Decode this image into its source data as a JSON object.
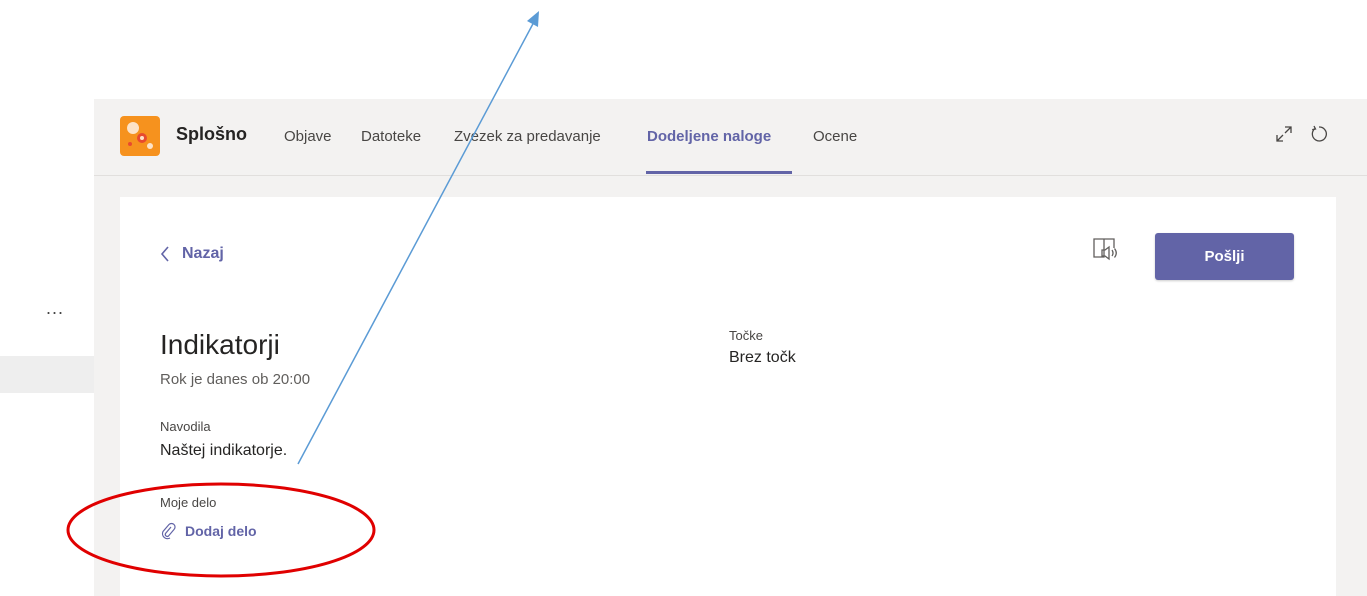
{
  "header": {
    "team_name": "Splošno",
    "tabs": [
      {
        "label": "Objave",
        "active": false
      },
      {
        "label": "Datoteke",
        "active": false
      },
      {
        "label": "Zvezek za predavanje",
        "active": false
      },
      {
        "label": "Dodeljene naloge",
        "active": true
      },
      {
        "label": "Ocene",
        "active": false
      }
    ],
    "icons": [
      "expand-icon",
      "refresh-icon"
    ]
  },
  "sidebar": {
    "more_label": "..."
  },
  "assignment": {
    "back_label": "Nazaj",
    "send_label": "Pošlji",
    "title": "Indikatorji",
    "due_text": "Rok je danes ob 20:00",
    "instructions_label": "Navodila",
    "instructions_text": "Naštej indikatorje.",
    "my_work_label": "Moje delo",
    "add_work_label": "Dodaj delo",
    "points_label": "Točke",
    "points_value": "Brez točk"
  },
  "colors": {
    "accent": "#6264a7",
    "team_avatar": "#f6921e",
    "annotation_arrow": "#5b9bd5",
    "annotation_ellipse": "#e00000"
  }
}
